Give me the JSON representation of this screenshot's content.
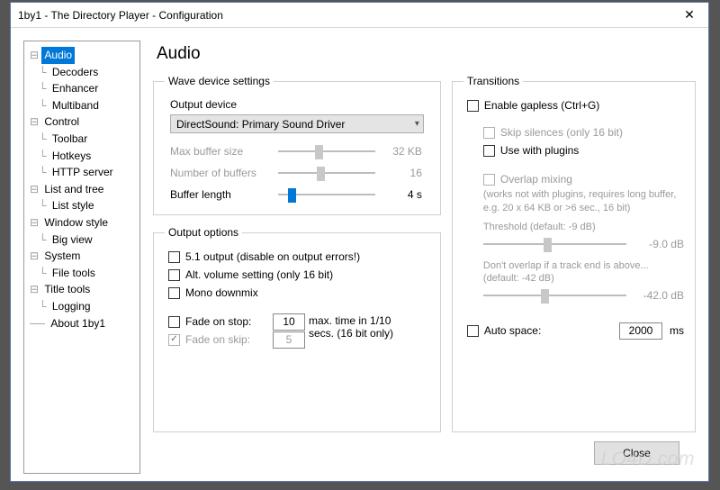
{
  "window": {
    "title": "1by1 - The Directory Player - Configuration"
  },
  "page": {
    "title": "Audio"
  },
  "tree": {
    "items": [
      {
        "label": "Audio",
        "depth": 0,
        "selected": true
      },
      {
        "label": "Decoders",
        "depth": 1
      },
      {
        "label": "Enhancer",
        "depth": 1
      },
      {
        "label": "Multiband",
        "depth": 1
      },
      {
        "label": "Control",
        "depth": 0
      },
      {
        "label": "Toolbar",
        "depth": 1
      },
      {
        "label": "Hotkeys",
        "depth": 1
      },
      {
        "label": "HTTP server",
        "depth": 1
      },
      {
        "label": "List and tree",
        "depth": 0
      },
      {
        "label": "List style",
        "depth": 1
      },
      {
        "label": "Window style",
        "depth": 0
      },
      {
        "label": "Big view",
        "depth": 1
      },
      {
        "label": "System",
        "depth": 0
      },
      {
        "label": "File tools",
        "depth": 1
      },
      {
        "label": "Title tools",
        "depth": 0
      },
      {
        "label": "Logging",
        "depth": 1
      },
      {
        "label": "About 1by1",
        "depth": 0
      }
    ]
  },
  "wave": {
    "legend": "Wave device settings",
    "output_label": "Output device",
    "output_value": "DirectSound: Primary Sound Driver",
    "maxbuf_label": "Max buffer size",
    "maxbuf_value": "32 KB",
    "numbuf_label": "Number of buffers",
    "numbuf_value": "16",
    "buflen_label": "Buffer length",
    "buflen_value": "4 s"
  },
  "output": {
    "legend": "Output options",
    "opt51": "5.1 output (disable on output errors!)",
    "altvol": "Alt. volume setting (only 16 bit)",
    "mono": "Mono downmix",
    "fade_stop": "Fade on stop:",
    "fade_stop_val": "10",
    "fade_skip": "Fade on skip:",
    "fade_skip_val": "5",
    "fade_hint1": "max. time in 1/10",
    "fade_hint2": "secs. (16 bit only)"
  },
  "trans": {
    "legend": "Transitions",
    "gapless": "Enable gapless (Ctrl+G)",
    "skip_sil": "Skip silences (only 16 bit)",
    "plugins": "Use with plugins",
    "overlap": "Overlap mixing",
    "overlap_note": "(works not with plugins, requires long buffer, e.g. 20 x 64 KB or >6 sec., 16 bit)",
    "thresh_label": "Threshold (default: -9 dB)",
    "thresh_val": "-9.0 dB",
    "dont_label": "Don't overlap if a track end is above... (default: -42 dB)",
    "dont_val": "-42.0 dB",
    "auto_space": "Auto space:",
    "auto_space_val": "2000",
    "auto_space_unit": "ms"
  },
  "footer": {
    "close": "Close"
  },
  "watermark": "LO4D.com"
}
